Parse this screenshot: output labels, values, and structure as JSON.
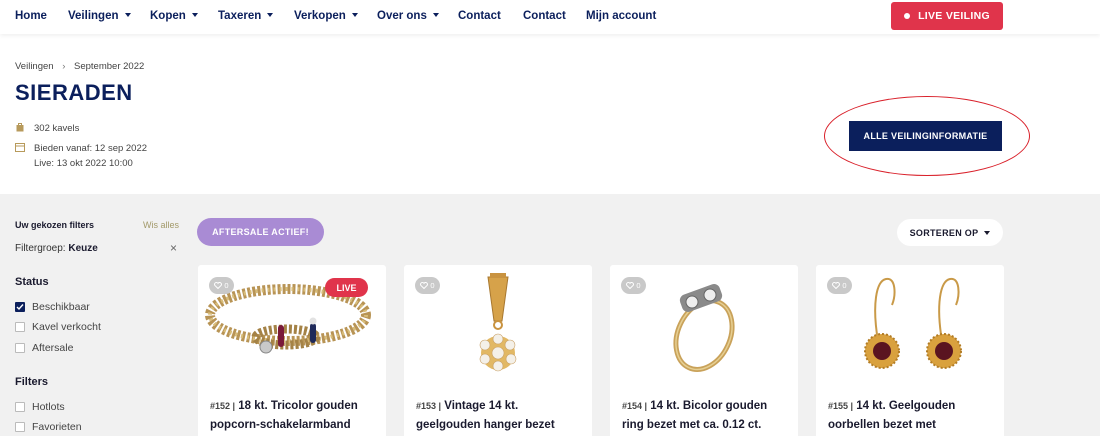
{
  "nav": {
    "items": [
      {
        "label": "Home",
        "dropdown": false
      },
      {
        "label": "Veilingen",
        "dropdown": true
      },
      {
        "label": "Kopen",
        "dropdown": true
      },
      {
        "label": "Taxeren",
        "dropdown": true
      },
      {
        "label": "Verkopen",
        "dropdown": true
      },
      {
        "label": "Over ons",
        "dropdown": true
      },
      {
        "label": "Contact",
        "dropdown": false
      },
      {
        "label": "Contact",
        "dropdown": false
      },
      {
        "label": "Mijn account",
        "dropdown": false
      }
    ],
    "live_button": "LIVE VEILING"
  },
  "breadcrumb": {
    "items": [
      "Veilingen",
      "September 2022"
    ]
  },
  "page_title": "SIERADEN",
  "meta": {
    "lots": "302 kavels",
    "bid_from": "Bieden vanaf: 12 sep 2022",
    "live": "Live: 13 okt 2022 10:00"
  },
  "info_button": "ALLE VEILINGINFORMATIE",
  "sidebar": {
    "chosen_filters": "Uw gekozen filters",
    "clear_all": "Wis alles",
    "filtergroup_label": "Filtergroep:",
    "filtergroup_value": "Keuze",
    "status_title": "Status",
    "status_options": [
      {
        "label": "Beschikbaar",
        "checked": true
      },
      {
        "label": "Kavel verkocht",
        "checked": false
      },
      {
        "label": "Aftersale",
        "checked": false
      }
    ],
    "filters_title": "Filters",
    "filter_options": [
      {
        "label": "Hotlots",
        "checked": false
      },
      {
        "label": "Favorieten",
        "checked": false
      }
    ]
  },
  "aftersale_button": "AFTERSALE ACTIEF!",
  "sort_button": "SORTEREN OP",
  "cards": [
    {
      "lot": "#152 |",
      "title_line1": "18 kt. Tricolor gouden",
      "title_line2": "popcorn-schakelarmband",
      "favorites": "0",
      "live": "LIVE"
    },
    {
      "lot": "#153 |",
      "title_line1": "Vintage 14 kt.",
      "title_line2": "geelgouden hanger bezet",
      "favorites": "0"
    },
    {
      "lot": "#154 |",
      "title_line1": "14 kt. Bicolor gouden",
      "title_line2": "ring bezet met ca. 0.12 ct.",
      "favorites": "0"
    },
    {
      "lot": "#155 |",
      "title_line1": "14 kt. Geelgouden",
      "title_line2": "oorbellen bezet met",
      "favorites": "0"
    }
  ],
  "colors": {
    "brand_navy": "#0b1f5c",
    "live_red": "#e0344b",
    "aftersale_purple": "#a98bd4",
    "annotation_red": "#d9202a"
  }
}
